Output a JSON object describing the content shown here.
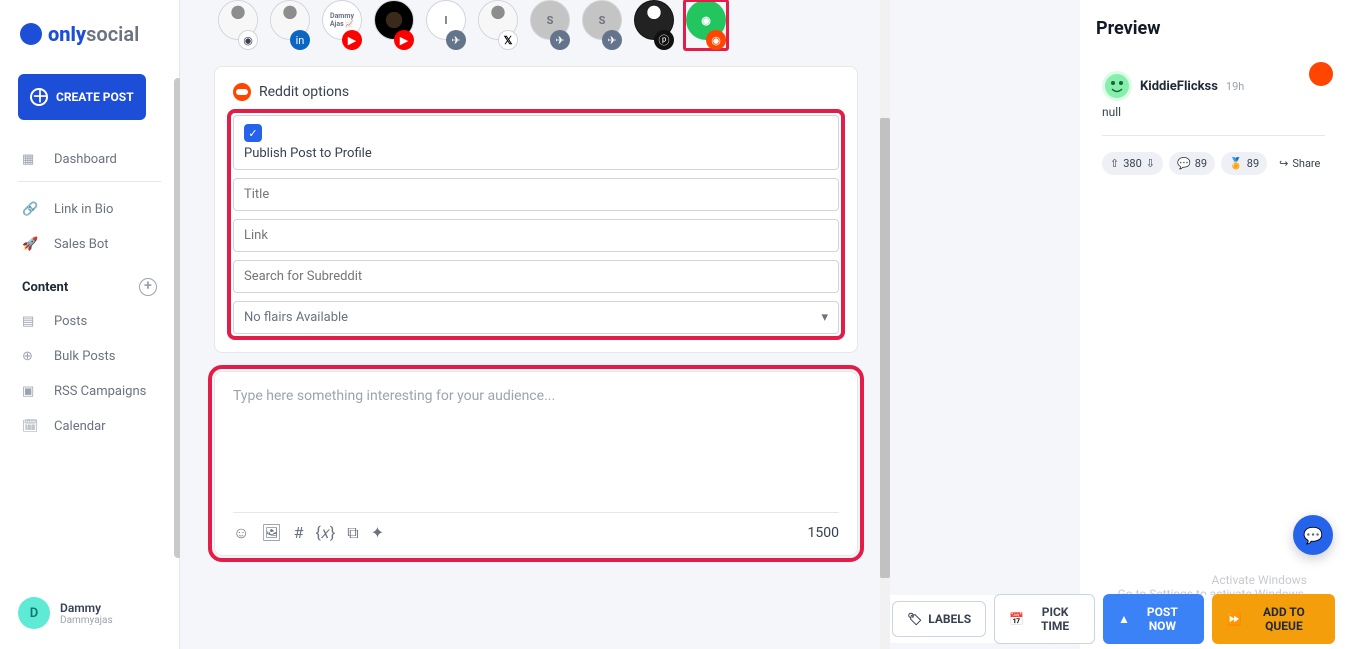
{
  "brand": {
    "only": "only",
    "social": "social"
  },
  "createBtn": "CREATE POST",
  "nav": {
    "dashboard": "Dashboard",
    "linkInBio": "Link in Bio",
    "salesBot": "Sales Bot"
  },
  "contentHeader": "Content",
  "contentNav": {
    "posts": "Posts",
    "bulkPosts": "Bulk Posts",
    "rss": "RSS Campaigns",
    "calendar": "Calendar"
  },
  "user": {
    "initial": "D",
    "name": "Dammy",
    "handle": "Dammyajas"
  },
  "socialRow": [
    {
      "avatar": "person",
      "net": "ig"
    },
    {
      "avatar": "person",
      "net": "li"
    },
    {
      "avatar": "Dammy Ajas",
      "net": "yt"
    },
    {
      "avatar": "coffee",
      "net": "yt"
    },
    {
      "avatar": "I",
      "net": "tg"
    },
    {
      "avatar": "person",
      "net": "x"
    },
    {
      "avatar": "S",
      "net": "tg"
    },
    {
      "avatar": "S",
      "net": "tg"
    },
    {
      "avatar": "darkperson",
      "net": "pt"
    },
    {
      "avatar": "alien",
      "net": "reddit",
      "selected": true
    }
  ],
  "redditOptions": {
    "title": "Reddit options",
    "publishLabel": "Publish Post to Profile",
    "placeholders": {
      "title": "Title",
      "link": "Link",
      "subreddit": "Search for Subreddit"
    },
    "flairs": "No flairs Available"
  },
  "compose": {
    "placeholder": "Type here something interesting for your audience...",
    "charCount": "1500"
  },
  "preview": {
    "heading": "Preview",
    "username": "KiddieFlickss",
    "time": "19h",
    "body": "null",
    "upvotes": "380",
    "comments": "89",
    "awards": "89",
    "share": "Share"
  },
  "bottomBar": {
    "labels": "LABELS",
    "pickTime": "PICK TIME",
    "postNow": "POST NOW",
    "addToQueue": "ADD TO QUEUE"
  },
  "watermark": {
    "line1": "Activate Windows",
    "line2": "Go to Settings to activate Windows."
  }
}
